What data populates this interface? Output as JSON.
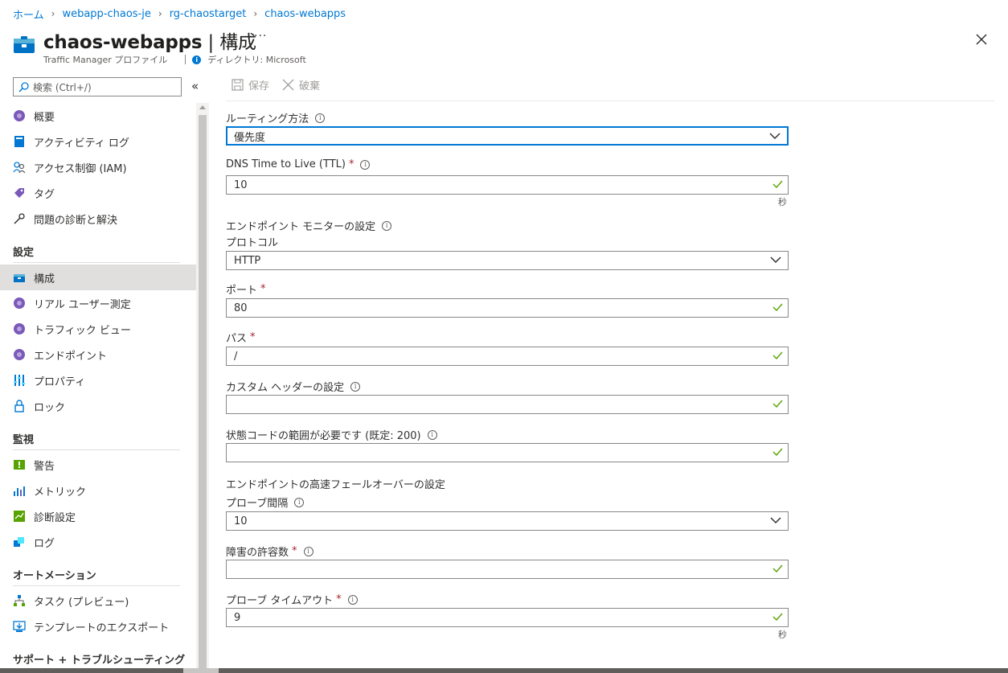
{
  "breadcrumb": {
    "items": [
      "ホーム",
      "webapp-chaos-je",
      "rg-chaostarget",
      "chaos-webapps"
    ]
  },
  "header": {
    "resource_name": "chaos-webapps",
    "title_suffix": " | 構成",
    "more_label": "···",
    "subtitle": "Traffic Manager プロファイル",
    "directory_label": "ディレクトリ: Microsoft"
  },
  "sidebar": {
    "search_placeholder": "検索 (Ctrl+/)",
    "collapse_label": "«",
    "items": [
      {
        "label": "概要",
        "icon": "overview-icon"
      },
      {
        "label": "アクティビティ ログ",
        "icon": "activity-log-icon"
      },
      {
        "label": "アクセス制御 (IAM)",
        "icon": "iam-icon"
      },
      {
        "label": "タグ",
        "icon": "tag-icon"
      },
      {
        "label": "問題の診断と解決",
        "icon": "wrench-icon"
      }
    ],
    "section_settings": "設定",
    "settings_items": [
      {
        "label": "構成",
        "icon": "configuration-icon",
        "selected": true
      },
      {
        "label": "リアル ユーザー測定",
        "icon": "real-user-icon"
      },
      {
        "label": "トラフィック ビュー",
        "icon": "traffic-view-icon"
      },
      {
        "label": "エンドポイント",
        "icon": "endpoint-icon"
      },
      {
        "label": "プロパティ",
        "icon": "properties-icon"
      },
      {
        "label": "ロック",
        "icon": "lock-icon"
      }
    ],
    "section_monitoring": "監視",
    "monitoring_items": [
      {
        "label": "警告",
        "icon": "alert-icon"
      },
      {
        "label": "メトリック",
        "icon": "metrics-icon"
      },
      {
        "label": "診断設定",
        "icon": "diagnostic-icon"
      },
      {
        "label": "ログ",
        "icon": "logs-icon"
      }
    ],
    "section_automation": "オートメーション",
    "automation_items": [
      {
        "label": "タスク (プレビュー)",
        "icon": "tasks-icon"
      },
      {
        "label": "テンプレートのエクスポート",
        "icon": "export-template-icon"
      }
    ],
    "section_support": "サポート + トラブルシューティング"
  },
  "toolbar": {
    "save_label": "保存",
    "discard_label": "破棄"
  },
  "form": {
    "routing_label": "ルーティング方法",
    "routing_value": "優先度",
    "ttl_label": "DNS Time to Live (TTL)",
    "ttl_value": "10",
    "ttl_unit": "秒",
    "monitor_section": "エンドポイント モニターの設定",
    "protocol_label": "プロトコル",
    "protocol_value": "HTTP",
    "port_label": "ポート",
    "port_value": "80",
    "path_label": "パス",
    "path_value": "/",
    "custom_header_label": "カスタム ヘッダーの設定",
    "custom_header_value": "",
    "status_code_label": "状態コードの範囲が必要です (既定: 200)",
    "status_code_value": "",
    "failover_section": "エンドポイントの高速フェールオーバーの設定",
    "probe_interval_label": "プローブ間隔",
    "probe_interval_value": "10",
    "tolerated_failures_label": "障害の許容数",
    "tolerated_failures_value": "",
    "probe_timeout_label": "プローブ タイムアウト",
    "probe_timeout_value": "9",
    "probe_timeout_unit": "秒",
    "required_mark": "*",
    "info_mark": "i"
  },
  "colors": {
    "accent": "#0078d4",
    "valid_check": "#57a300",
    "required": "#a4262c"
  }
}
